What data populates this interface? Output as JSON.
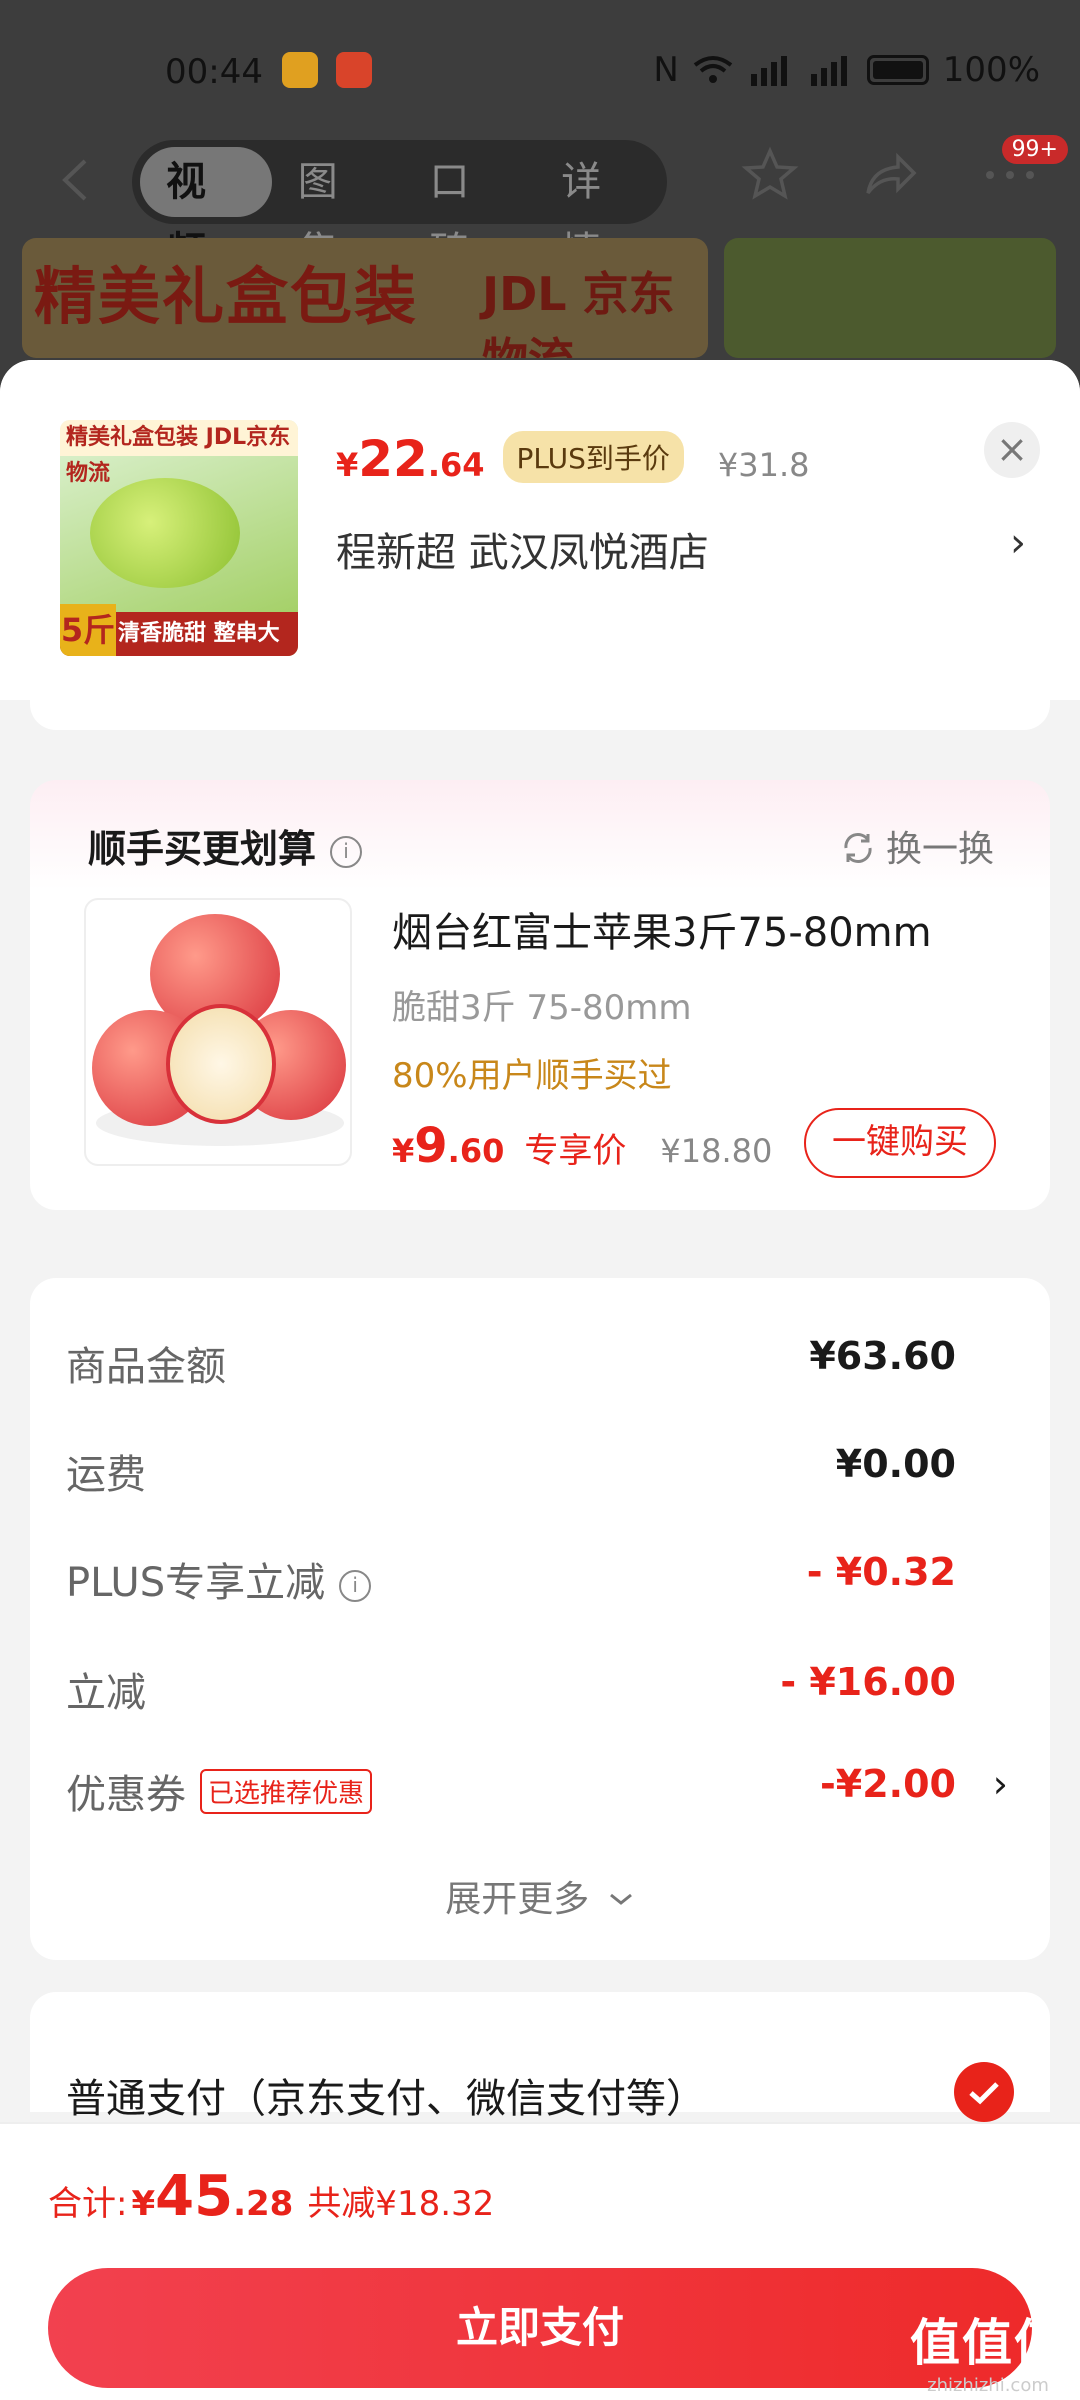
{
  "status_bar": {
    "time": "00:44",
    "battery": "100%",
    "network": "5G"
  },
  "nav": {
    "tabs": [
      {
        "label": "视频",
        "active": true
      },
      {
        "label": "图集",
        "active": false
      },
      {
        "label": "口碑",
        "active": false
      },
      {
        "label": "详情",
        "active": false
      }
    ],
    "badge": "99+"
  },
  "banner": {
    "text": "精美礼盒包装",
    "logistics": "JDL 京东物流"
  },
  "product": {
    "image_top_text": "精美礼盒包装 JDL京东物流",
    "image_weight": "5斤",
    "image_bottom_text": "清香脆甜 整串大果",
    "price_currency": "¥",
    "price_int": "22",
    "price_dec": ".64",
    "plus_tag": "PLUS到手价",
    "original_price": "¥31.8",
    "address": "程新超  武汉凤悦酒店"
  },
  "upsell": {
    "title": "顺手买更划算",
    "swap_label": "换一换",
    "item_name": "烟台红富士苹果3斤75-80mm",
    "item_spec": "脆甜3斤 75-80mm",
    "item_note": "80%用户顺手买过",
    "price_currency": "¥",
    "price_int": "9",
    "price_dec": ".60",
    "exclusive_label": "专享价",
    "original_price": "¥18.80",
    "buy_button": "一键购买"
  },
  "summary": {
    "rows": [
      {
        "label": "商品金额",
        "value": "¥63.60"
      },
      {
        "label": "运费",
        "value": "¥0.00"
      },
      {
        "label": "PLUS专享立减",
        "value": "- ¥0.32"
      },
      {
        "label": "立减",
        "value": "- ¥16.00"
      },
      {
        "label": "优惠券",
        "value": "-¥2.00",
        "tag": "已选推荐优惠"
      }
    ],
    "expand_label": "展开更多"
  },
  "payment": {
    "method": "普通支付（京东支付、微信支付等）",
    "selected": true
  },
  "footer": {
    "total_label": "合计:",
    "total_currency": "¥",
    "total_int": "45",
    "total_dec": ".28",
    "saved_label": "共减¥18.32",
    "pay_button": "立即支付"
  },
  "watermark": {
    "main": "值值值",
    "sub": "zhizhizhi.com"
  },
  "colors": {
    "accent": "#e8231a",
    "plus_bg": "#f6e2a8",
    "note": "#c8871a"
  }
}
